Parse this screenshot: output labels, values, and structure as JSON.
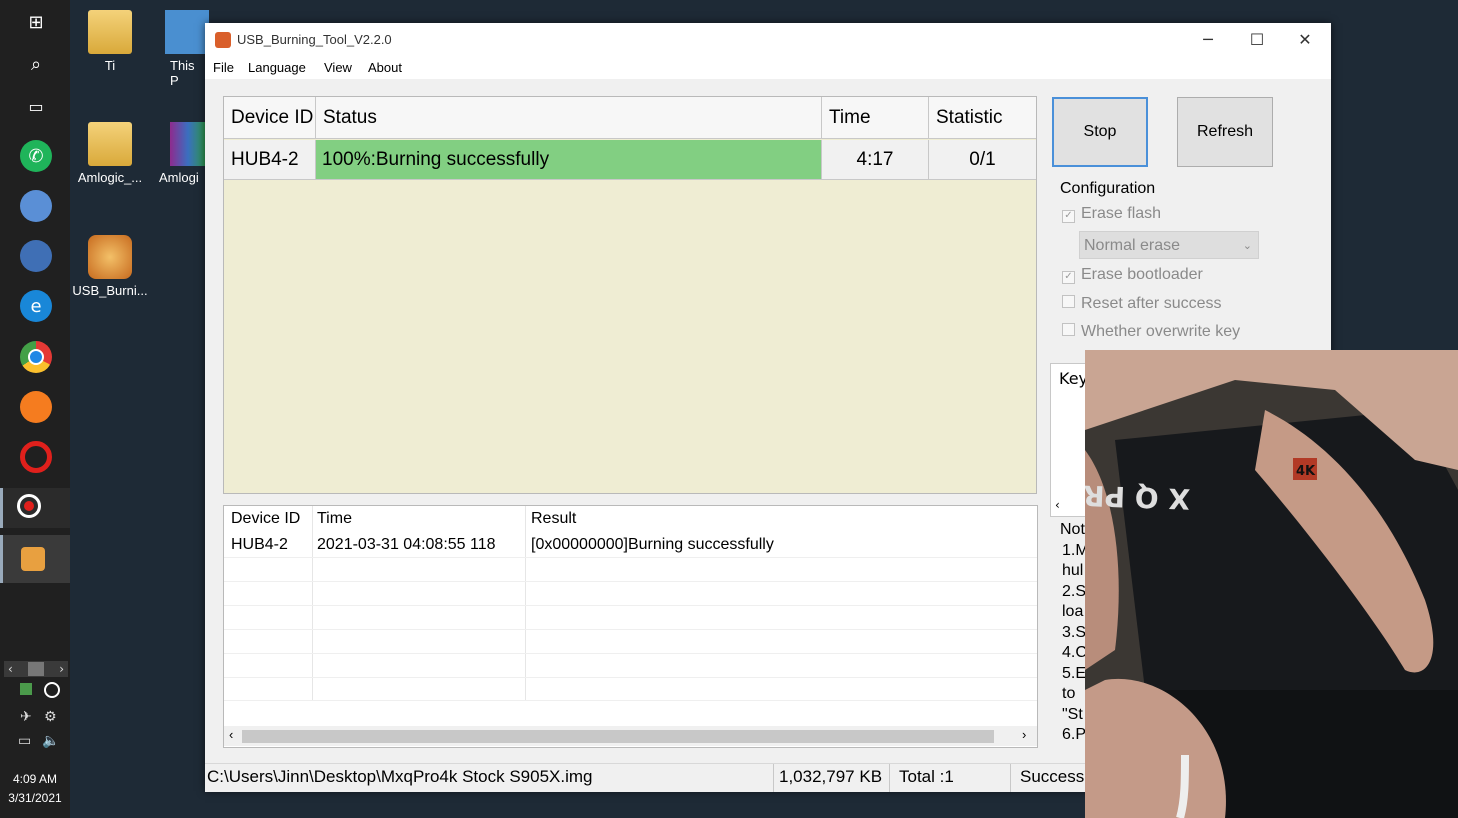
{
  "taskbar": {
    "clock_time": "4:09 AM",
    "clock_date": "3/31/2021"
  },
  "desktop": {
    "icons": [
      {
        "label": "Ti"
      },
      {
        "label": "This P"
      },
      {
        "label": "Amlogic_..."
      },
      {
        "label": "Amlogi"
      },
      {
        "label": "USB_Burni..."
      }
    ]
  },
  "window": {
    "title": "USB_Burning_Tool_V2.2.0",
    "menu": [
      "File",
      "Language",
      "View",
      "About"
    ]
  },
  "device_grid": {
    "headers": [
      "Device ID",
      "Status",
      "Time",
      "Statistic"
    ],
    "rows": [
      {
        "device_id": "HUB4-2",
        "status": "100%:Burning successfully",
        "time": "4:17",
        "statistic": "0/1"
      }
    ],
    "progress": 1.0,
    "progress_color": "#82cf82"
  },
  "buttons": {
    "stop": "Stop",
    "refresh": "Refresh"
  },
  "configuration": {
    "title": "Configuration",
    "erase_flash": "Erase flash",
    "erase_mode": "Normal erase",
    "erase_bootloader": "Erase bootloader",
    "reset_after_success": "Reset after success",
    "overwrite_key": "Whether overwrite key"
  },
  "key_panel": {
    "label": "Key"
  },
  "notes": {
    "lines": [
      "Not",
      "1.M",
      "hul",
      "2.S",
      "loa",
      "3.S",
      "4.C",
      "5.E",
      "to",
      "\"St",
      "6.P"
    ]
  },
  "log": {
    "headers": [
      "Device ID",
      "Time",
      "Result"
    ],
    "rows": [
      {
        "device_id": "HUB4-2",
        "time": "2021-03-31 04:08:55 118",
        "result": "[0x00000000]Burning successfully"
      }
    ]
  },
  "status_bar": {
    "path": "C:\\Users\\Jinn\\Desktop\\MxqPro4k Stock S905X.img",
    "size": "1,032,797 KB",
    "total": "Total :1",
    "success": "Success:"
  },
  "overlay": {
    "box_text": "X Q PRO",
    "badge": "4K"
  }
}
